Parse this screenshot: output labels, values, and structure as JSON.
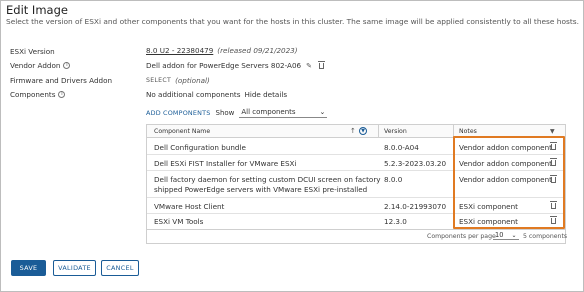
{
  "dialog": {
    "title": "Edit Image",
    "subtitle": "Select the version of ESXi and other components that you want for the hosts in this cluster. The same image will be applied consistently to all these hosts."
  },
  "fields": {
    "esxi_version": {
      "label": "ESXi Version",
      "value": "8.0 U2 - 22380479",
      "note": "(released 09/21/2023)"
    },
    "vendor_addon": {
      "label": "Vendor Addon",
      "value": "Dell addon for PowerEdge Servers 802-A06"
    },
    "firmware": {
      "label": "Firmware and Drivers Addon",
      "action": "SELECT",
      "note": "(optional)"
    },
    "components": {
      "label": "Components",
      "value": "No additional components",
      "link": "Hide details"
    }
  },
  "toolbar": {
    "add_components": "ADD COMPONENTS",
    "show_label": "Show",
    "show_value": "All components"
  },
  "table": {
    "columns": [
      "Component Name",
      "Version",
      "Notes"
    ],
    "rows": [
      {
        "name": "Dell Configuration bundle",
        "version": "8.0.0-A04",
        "notes": "Vendor addon component"
      },
      {
        "name": "Dell ESXi FIST Installer for VMware ESXi",
        "version": "5.2.3-2023.03.20",
        "notes": "Vendor addon component"
      },
      {
        "name": "Dell factory daemon for setting custom DCUI screen on factory",
        "name2": "shipped PowerEdge servers with VMware ESXi pre-installed",
        "version": "8.0.0",
        "notes": "Vendor addon component"
      },
      {
        "name": "VMware Host Client",
        "version": "2.14.0-21993070",
        "notes": "ESXi component"
      },
      {
        "name": "ESXi VM Tools",
        "version": "12.3.0",
        "notes": "ESXi component"
      }
    ],
    "footer": {
      "per_page_label": "Components per page",
      "per_page_value": "10",
      "count": "5 components"
    }
  },
  "buttons": {
    "save": "SAVE",
    "validate": "VALIDATE",
    "cancel": "CANCEL"
  },
  "colors": {
    "primary": "#1a5c97",
    "highlight": "#e07a22"
  }
}
